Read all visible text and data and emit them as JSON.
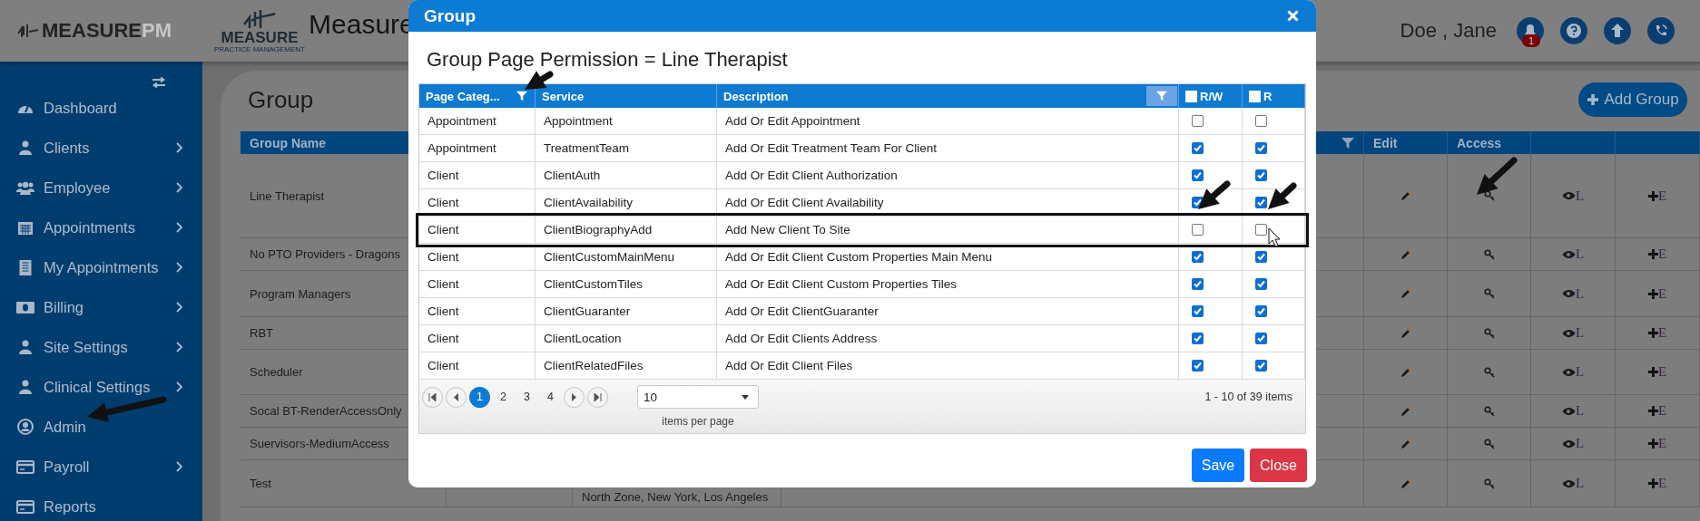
{
  "header": {
    "brand_main": "MEASURE",
    "brand_suffix": "PM",
    "logo_word": "MEASURE",
    "logo_tagline": "PRACTICE MANAGEMENT",
    "app_title": "Measure",
    "user_name": "Doe , Jane",
    "notification_count": "1"
  },
  "sidebar": {
    "items": [
      {
        "label": "Dashboard",
        "expandable": false
      },
      {
        "label": "Clients",
        "expandable": true
      },
      {
        "label": "Employee",
        "expandable": true
      },
      {
        "label": "Appointments",
        "expandable": true
      },
      {
        "label": "My Appointments",
        "expandable": true
      },
      {
        "label": "Billing",
        "expandable": true
      },
      {
        "label": "Site Settings",
        "expandable": true
      },
      {
        "label": "Clinical Settings",
        "expandable": true
      },
      {
        "label": "Admin",
        "expandable": false
      },
      {
        "label": "Payroll",
        "expandable": true
      },
      {
        "label": "Reports",
        "expandable": false
      }
    ]
  },
  "page": {
    "title": "Group",
    "add_button": "Add Group",
    "table": {
      "headers": {
        "name": "Group Name",
        "edit": "Edit",
        "access": "Access"
      },
      "rows": [
        {
          "name": "Line Therapist",
          "view_label": "L",
          "add_label": "E"
        },
        {
          "name": "No PTO Providers - Dragons",
          "view_label": "L",
          "add_label": "E"
        },
        {
          "name": "Program Managers",
          "view_label": "L",
          "add_label": "E"
        },
        {
          "name": "RBT",
          "view_label": "L",
          "add_label": "E"
        },
        {
          "name": "Scheduler",
          "view_label": "L",
          "add_label": "E"
        },
        {
          "name": "Socal BT-RenderAccessOnly",
          "view_label": "L",
          "add_label": "E"
        },
        {
          "name": "Suervisors-MediumAccess",
          "view_label": "L",
          "add_label": "E"
        },
        {
          "name": "Test",
          "region": "North Zone, New York, Los Angeles",
          "view_label": "L",
          "add_label": "E"
        }
      ]
    }
  },
  "dialog": {
    "title": "Group",
    "heading": "Group Page Permission = Line Therapist",
    "columns": [
      {
        "label": "Page Categ...",
        "kind": "filter"
      },
      {
        "label": "Service",
        "kind": "text"
      },
      {
        "label": "Description",
        "kind": "filter_box"
      },
      {
        "label": "R/W",
        "kind": "check",
        "checked": false
      },
      {
        "label": "R",
        "kind": "check",
        "checked": false
      }
    ],
    "rows": [
      {
        "category": "Appointment",
        "service": "Appointment",
        "description": "Add Or Edit Appointment",
        "rw": false,
        "r": false,
        "outlined": false
      },
      {
        "category": "Appointment",
        "service": "TreatmentTeam",
        "description": "Add Or Edit Treatment Team For Client",
        "rw": true,
        "r": true,
        "outlined": false
      },
      {
        "category": "Client",
        "service": "ClientAuth",
        "description": "Add Or Edit Client Authorization",
        "rw": true,
        "r": true,
        "outlined": false
      },
      {
        "category": "Client",
        "service": "ClientAvailability",
        "description": "Add Or Edit Client Availability",
        "rw": true,
        "r": true,
        "outlined": false
      },
      {
        "category": "Client",
        "service": "ClientBiographyAdd",
        "description": "Add New Client To Site",
        "rw": false,
        "r": false,
        "outlined": true
      },
      {
        "category": "Client",
        "service": "ClientCustomMainMenu",
        "description": "Add Or Edit Client Custom Properties Main Menu",
        "rw": true,
        "r": true,
        "outlined": false
      },
      {
        "category": "Client",
        "service": "ClientCustomTiles",
        "description": "Add Or Edit Client Custom Properties Tiles",
        "rw": true,
        "r": true,
        "outlined": false
      },
      {
        "category": "Client",
        "service": "ClientGuaranter",
        "description": "Add Or Edit ClientGuaranter",
        "rw": true,
        "r": true,
        "outlined": false
      },
      {
        "category": "Client",
        "service": "ClientLocation",
        "description": "Add Or Edit Clients Address",
        "rw": true,
        "r": true,
        "outlined": false
      },
      {
        "category": "Client",
        "service": "ClientRelatedFiles",
        "description": "Add Or Edit Client Files",
        "rw": true,
        "r": true,
        "outlined": false
      }
    ],
    "pager": {
      "pages": [
        {
          "label": "1",
          "selected": true
        },
        {
          "label": "2",
          "selected": false
        },
        {
          "label": "3",
          "selected": false
        },
        {
          "label": "4",
          "selected": false
        }
      ],
      "page_size": "10",
      "page_size_label": "items per page",
      "summary": "1 - 10 of 39 items"
    },
    "buttons": {
      "save": "Save",
      "close": "Close"
    }
  }
}
